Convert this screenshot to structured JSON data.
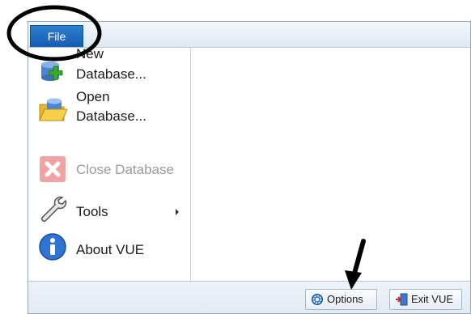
{
  "ribbon": {
    "file_tab": "File"
  },
  "menu": {
    "items": [
      {
        "label": "New Database...",
        "lines": [
          "New",
          "Database..."
        ],
        "icon": "new-database-icon",
        "enabled": true,
        "submenu": false
      },
      {
        "label": "Open Database...",
        "lines": [
          "Open",
          "Database..."
        ],
        "icon": "open-database-icon",
        "enabled": true,
        "submenu": false
      },
      {
        "label": "Close Database",
        "icon": "close-database-icon",
        "enabled": false,
        "submenu": false
      },
      {
        "label": "Tools",
        "icon": "wrench-icon",
        "enabled": true,
        "submenu": true
      },
      {
        "label": "About VUE",
        "icon": "info-icon",
        "enabled": true,
        "submenu": false
      }
    ]
  },
  "footer": {
    "options_label": "Options",
    "exit_label": "Exit VUE",
    "options_icon": "gear-icon",
    "exit_icon": "exit-door-icon"
  },
  "colors": {
    "file_tab": "#1f6fc3",
    "annotation": "#000000",
    "disabled_text": "#9a9a9a"
  }
}
